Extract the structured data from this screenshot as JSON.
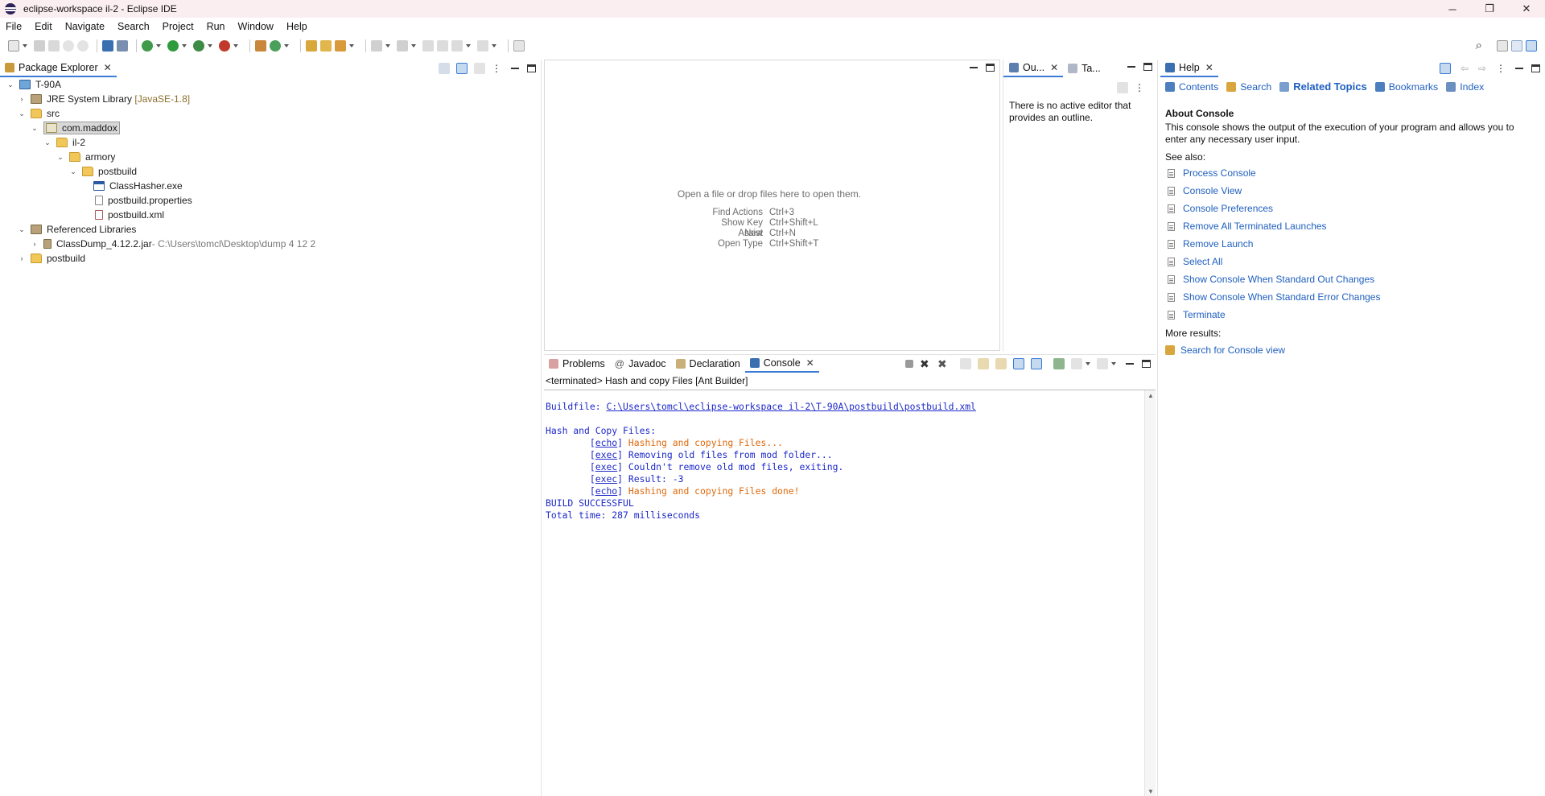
{
  "window": {
    "title": "eclipse-workspace il-2 - Eclipse IDE",
    "controls": {
      "minimize": "─",
      "restore": "❐",
      "close": "✕"
    }
  },
  "menu": [
    "File",
    "Edit",
    "Navigate",
    "Search",
    "Project",
    "Run",
    "Window",
    "Help"
  ],
  "package_explorer": {
    "tab_label": "Package Explorer",
    "tree": [
      {
        "label": "T-90A",
        "icon": "project-icon"
      },
      {
        "label": "JRE System Library",
        "suffix": "[JavaSE-1.8]",
        "icon": "library-icon"
      },
      {
        "label": "src",
        "icon": "source-folder-icon"
      },
      {
        "label": "com.maddox",
        "icon": "package-icon"
      },
      {
        "label": "il-2",
        "icon": "folder-icon"
      },
      {
        "label": "armory",
        "icon": "folder-icon"
      },
      {
        "label": "postbuild",
        "icon": "folder-icon"
      },
      {
        "label": "ClassHasher.exe",
        "icon": "exe-file-icon"
      },
      {
        "label": "postbuild.properties",
        "icon": "properties-file-icon"
      },
      {
        "label": "postbuild.xml",
        "icon": "xml-file-icon"
      },
      {
        "label": "Referenced Libraries",
        "icon": "library-icon"
      },
      {
        "label": "ClassDump_4.12.2.jar",
        "suffix": " - C:\\Users\\tomcl\\Desktop\\dump 4 12  2",
        "icon": "jar-icon"
      },
      {
        "label": "postbuild",
        "icon": "folder-icon"
      }
    ]
  },
  "editor": {
    "hint": "Open a file or drop files here to open them.",
    "shortcuts": [
      {
        "name": "Find Actions",
        "key": "Ctrl+3"
      },
      {
        "name": "Show Key Assist",
        "key": "Ctrl+Shift+L"
      },
      {
        "name": "New",
        "key": "Ctrl+N"
      },
      {
        "name": "Open Type",
        "key": "Ctrl+Shift+T"
      }
    ]
  },
  "outline": {
    "tab1": "Ou...",
    "tab2": "Ta...",
    "message": "There is no active editor that provides an outline."
  },
  "bottom": {
    "tabs": [
      "Problems",
      "Javadoc",
      "Declaration",
      "Console"
    ],
    "console_header": "<terminated> Hash and copy Files [Ant Builder]",
    "buildfile_label": "Buildfile: ",
    "buildfile_path": "C:\\Users\\tomcl\\eclipse-workspace il-2\\T-90A\\postbuild\\postbuild.xml",
    "target": "Hash and Copy Files:",
    "lines": [
      {
        "tag": "echo",
        "text": "Hashing and copying Files..."
      },
      {
        "tag": "exec",
        "text": "Removing old files from mod folder..."
      },
      {
        "tag": "exec",
        "text": "Couldn't remove old mod files, exiting."
      },
      {
        "tag": "exec",
        "text": "Result: -3"
      },
      {
        "tag": "echo",
        "text": "Hashing and copying Files done!"
      }
    ],
    "status": "BUILD SUCCESSFUL",
    "total": "Total time: 287 milliseconds"
  },
  "help": {
    "tab_label": "Help",
    "nav": [
      "Contents",
      "Search",
      "Related Topics",
      "Bookmarks",
      "Index"
    ],
    "heading": "About Console",
    "description": "This console shows the output of the execution of your program and allows you to enter any necessary user input.",
    "see_also": "See also:",
    "links": [
      "Process Console",
      "Console View",
      "Console Preferences",
      "Remove All Terminated Launches",
      "Remove Launch",
      "Select All",
      "Show Console When Standard Out Changes",
      "Show Console When Standard Error Changes",
      "Terminate"
    ],
    "more_results": "More results:",
    "search_link": "Search for Console view"
  },
  "colors": {
    "accent": "#3a7bd5",
    "link_blue": "#1f5fbf",
    "console_blue": "#1c28c8",
    "console_orange": "#e0690c",
    "title_bar": "#fbeef1"
  }
}
